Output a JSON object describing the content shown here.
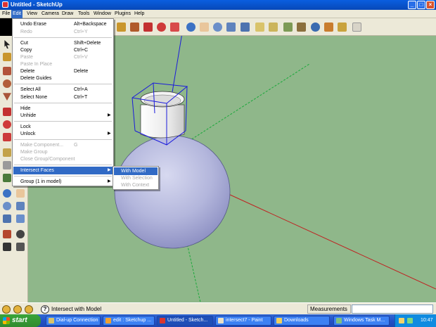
{
  "window": {
    "title": "Untitled - SketchUp"
  },
  "menubar": [
    "File",
    "Edit",
    "View",
    "Camera",
    "Draw",
    "Tools",
    "Window",
    "Plugins",
    "Help"
  ],
  "edit_menu": {
    "items": [
      {
        "label": "Undo Erase",
        "shortcut": "Alt+Backspace",
        "disabled": false
      },
      {
        "label": "Redo",
        "shortcut": "Ctrl+Y",
        "disabled": true
      },
      {
        "label": "Cut",
        "shortcut": "Shift+Delete",
        "disabled": false
      },
      {
        "label": "Copy",
        "shortcut": "Ctrl+C",
        "disabled": false
      },
      {
        "label": "Paste",
        "shortcut": "Ctrl+V",
        "disabled": true
      },
      {
        "label": "Paste In Place",
        "shortcut": "",
        "disabled": true
      },
      {
        "label": "Delete",
        "shortcut": "Delete",
        "disabled": false
      },
      {
        "label": "Delete Guides",
        "shortcut": "",
        "disabled": false
      },
      {
        "label": "Select All",
        "shortcut": "Ctrl+A",
        "disabled": false
      },
      {
        "label": "Select None",
        "shortcut": "Ctrl+T",
        "disabled": false
      },
      {
        "label": "Hide",
        "shortcut": "",
        "disabled": false
      },
      {
        "label": "Unhide",
        "shortcut": "",
        "disabled": false,
        "submenu": true
      },
      {
        "label": "Lock",
        "shortcut": "",
        "disabled": false
      },
      {
        "label": "Unlock",
        "shortcut": "",
        "disabled": false,
        "submenu": true
      },
      {
        "label": "Make Component...",
        "shortcut": "G",
        "disabled": true
      },
      {
        "label": "Make Group",
        "shortcut": "",
        "disabled": true
      },
      {
        "label": "Close Group/Component",
        "shortcut": "",
        "disabled": true
      },
      {
        "label": "Intersect Faces",
        "shortcut": "",
        "disabled": false,
        "submenu": true,
        "highlighted": true
      },
      {
        "label": "Group (1 in model)",
        "shortcut": "",
        "disabled": false,
        "submenu": true
      }
    ]
  },
  "intersect_submenu": {
    "items": [
      {
        "label": "With Model",
        "disabled": false,
        "highlighted": true
      },
      {
        "label": "With Selection",
        "disabled": true
      },
      {
        "label": "With Context",
        "disabled": true
      }
    ]
  },
  "status": {
    "text": "Intersect with Model",
    "measurements_label": "Measurements",
    "measurements_value": ""
  },
  "taskbar": {
    "start_label": "start",
    "tasks": [
      {
        "label": "Dial-up Connection",
        "icon": "network-icon",
        "color": "#d8c36a",
        "active": false
      },
      {
        "label": "edit : Sketchup ...",
        "icon": "browser-icon",
        "color": "#f0a030",
        "active": false
      },
      {
        "label": "Untitled - Sketch...",
        "icon": "sketchup-icon",
        "color": "#d9362f",
        "active": true
      },
      {
        "label": "intersect7 - Paint",
        "icon": "paint-icon",
        "color": "#e9e0c6",
        "active": false
      },
      {
        "label": "Downloads",
        "icon": "folder-icon",
        "color": "#f1cf5c",
        "active": false
      },
      {
        "label": "Windows Task M...",
        "icon": "task-manager-icon",
        "color": "#7fbf7f",
        "active": false
      }
    ],
    "clock": "10:47"
  },
  "colors": {
    "viewport_bg": "#8fb78a",
    "selection_blue": "#1a1adc",
    "menu_highlight": "#316ac5"
  }
}
